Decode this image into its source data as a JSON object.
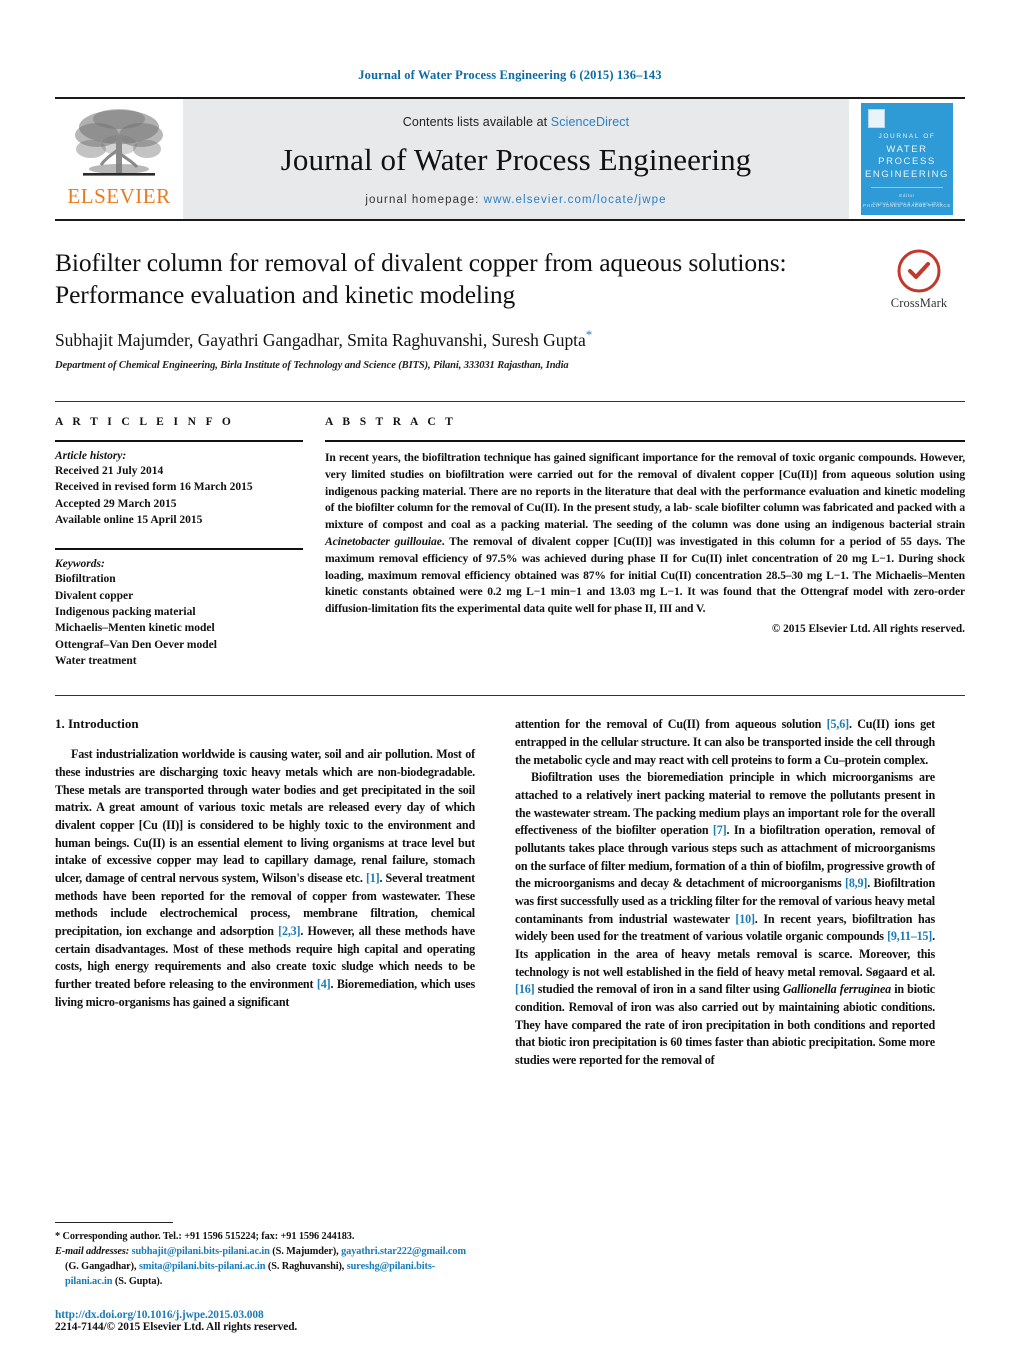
{
  "running_head": "Journal of Water Process Engineering 6 (2015) 136–143",
  "masthead": {
    "publisher_name": "ELSEVIER",
    "contents_prefix": "Contents lists available at ",
    "contents_link": "ScienceDirect",
    "journal_title": "Journal of Water Process Engineering",
    "homepage_label": "journal homepage:",
    "homepage_url": "www.elsevier.com/locate/jwpe",
    "cover": {
      "line1": "JOURNAL OF",
      "line2": "WATER PROCESS",
      "line3": "ENGINEERING",
      "editors_label": "Editor",
      "editors": "PHILIP JONES    GRAEME PEARCE",
      "footer": "Journal   Volume 6   January 2015"
    }
  },
  "article": {
    "title": "Biofilter column for removal of divalent copper from aqueous solutions: Performance evaluation and kinetic modeling",
    "authors": "Subhajit Majumder, Gayathri Gangadhar, Smita Raghuvanshi, Suresh Gupta",
    "author_star": "*",
    "affiliation": "Department of Chemical Engineering, Birla Institute of Technology and Science (BITS), Pilani, 333031 Rajasthan, India",
    "crossmark_label": "CrossMark"
  },
  "article_info": {
    "heading": "A R T I C L E   I N F O",
    "history_title": "Article history:",
    "history": [
      "Received 21 July 2014",
      "Received in revised form 16 March 2015",
      "Accepted 29 March 2015",
      "Available online 15 April 2015"
    ],
    "keywords_title": "Keywords:",
    "keywords": [
      "Biofiltration",
      "Divalent copper",
      "Indigenous packing material",
      "Michaelis–Menten kinetic model",
      "Ottengraf–Van Den Oever model",
      "Water treatment"
    ]
  },
  "abstract": {
    "heading": "A B S T R A C T",
    "part1": "In recent years, the biofiltration technique has gained significant importance for the removal of toxic organic compounds. However, very limited studies on biofiltration were carried out for the removal of divalent copper [Cu(II)] from aqueous solution using indigenous packing material. There are no reports in the literature that deal with the performance evaluation and kinetic modeling of the biofilter column for the removal of Cu(II). In the present study, a lab- scale biofilter column was fabricated and packed with a mixture of compost and coal as a packing material. The seeding of the column was done using an indigenous bacterial strain ",
    "species1": "Acinetobacter guillouiae",
    "part2": ". The removal of divalent copper [Cu(II)] was investigated in this column for a period of 55 days. The maximum removal efficiency of 97.5% was achieved during phase II for Cu(II) inlet concentration of 20 mg L−1. During shock loading, maximum removal efficiency obtained was 87% for initial Cu(II) concentration 28.5–30 mg L−1. The Michaelis–Menten kinetic constants obtained were 0.2 mg L−1 min−1 and 13.03 mg L−1. It was found that the Ottengraf model with zero-order diffusion-limitation fits the experimental data quite well for phase II, III and V.",
    "copyright": "© 2015 Elsevier Ltd. All rights reserved."
  },
  "body": {
    "section_heading": "1.  Introduction",
    "left_para1_a": "Fast industrialization worldwide is causing water, soil and air pollution. Most of these industries are discharging toxic heavy metals which are non-biodegradable. These metals are transported through water bodies and get precipitated in the soil matrix. A great amount of various toxic metals are released every day of which divalent copper [Cu (II)] is considered to be highly toxic to the environment and human beings. Cu(II) is an essential element to living organisms at trace level but intake of excessive copper may lead to capillary damage, renal failure, stomach ulcer, damage of central nervous system, Wilson's disease etc. ",
    "ref1": "[1]",
    "left_para1_b": ". Several treatment methods have been reported for the removal of copper from wastewater. These methods include electrochemical process, membrane filtration, chemical precipitation, ion exchange and adsorption ",
    "ref2": "[2,3]",
    "left_para1_c": ". However, all these methods have certain disadvantages. Most of these methods require high capital and operating costs, high energy requirements and also create toxic sludge which needs to be further treated before releasing to the environment ",
    "ref3": "[4]",
    "left_para1_d": ". Bioremediation, which uses living micro-organisms has gained a significant",
    "right_para1_a": "attention for the removal of Cu(II) from aqueous solution ",
    "ref4": "[5,6]",
    "right_para1_b": ". Cu(II) ions get entrapped in the cellular structure. It can also be transported inside the cell through the metabolic cycle and may react with cell proteins to form a Cu–protein complex.",
    "right_para2_a": "Biofiltration uses the bioremediation principle in which microorganisms are attached to a relatively inert packing material to remove the pollutants present in the wastewater stream. The packing medium plays an important role for the overall effectiveness of the biofilter operation ",
    "ref5": "[7]",
    "right_para2_b": ". In a biofiltration operation, removal of pollutants takes place through various steps such as attachment of microorganisms on the surface of filter medium, formation of a thin of biofilm, progressive growth of the microorganisms and decay & detachment of microorganisms ",
    "ref6": "[8,9]",
    "right_para2_c": ". Biofiltration was first successfully used as a trickling filter for the removal of various heavy metal contaminants from industrial wastewater ",
    "ref7": "[10]",
    "right_para2_d": ". In recent years, biofiltration has widely been used for the treatment of various volatile organic compounds ",
    "ref8": "[9,11–15]",
    "right_para2_e": ". Its application in the area of heavy metals removal is scarce. Moreover, this technology is not well established in the field of heavy metal removal. Søgaard et al. ",
    "ref9": "[16]",
    "right_para2_f": " studied the removal of iron in a sand filter using ",
    "species2": "Gallionella ferruginea",
    "right_para2_g": " in biotic condition. Removal of iron was also carried out by maintaining abiotic conditions. They have compared the rate of iron precipitation in both conditions and reported that biotic iron precipitation is 60 times faster than abiotic precipitation. Some more studies were reported for the removal of"
  },
  "footnotes": {
    "corresponding_star": "*",
    "corresponding": " Corresponding author. Tel.: +91 1596 515224; fax: +91 1596 244183.",
    "emails_label": "E-mail addresses:",
    "email1": "subhajit@pilani.bits-pilani.ac.in",
    "email1_who": " (S. Majumder),",
    "email2": "gayathri.star222@gmail.com",
    "email2_who": " (G. Gangadhar),",
    "email3": "smita@pilani.bits-pilani.ac.in",
    "email3_who": " (S. Raghuvanshi),",
    "email4": "sureshg@pilani.bits-pilani.ac.in",
    "email4_who": " (S. Gupta).",
    "doi": "http://dx.doi.org/10.1016/j.jwpe.2015.03.008",
    "issn_line": "2214-7144/© 2015 Elsevier Ltd. All rights reserved."
  },
  "colors": {
    "link": "#1a7cb8",
    "journal_blue": "#0b6ba5",
    "elsevier_orange": "#E87C21",
    "cover_blue": "#2e9bd6",
    "masthead_grey": "#e8e9ea"
  }
}
